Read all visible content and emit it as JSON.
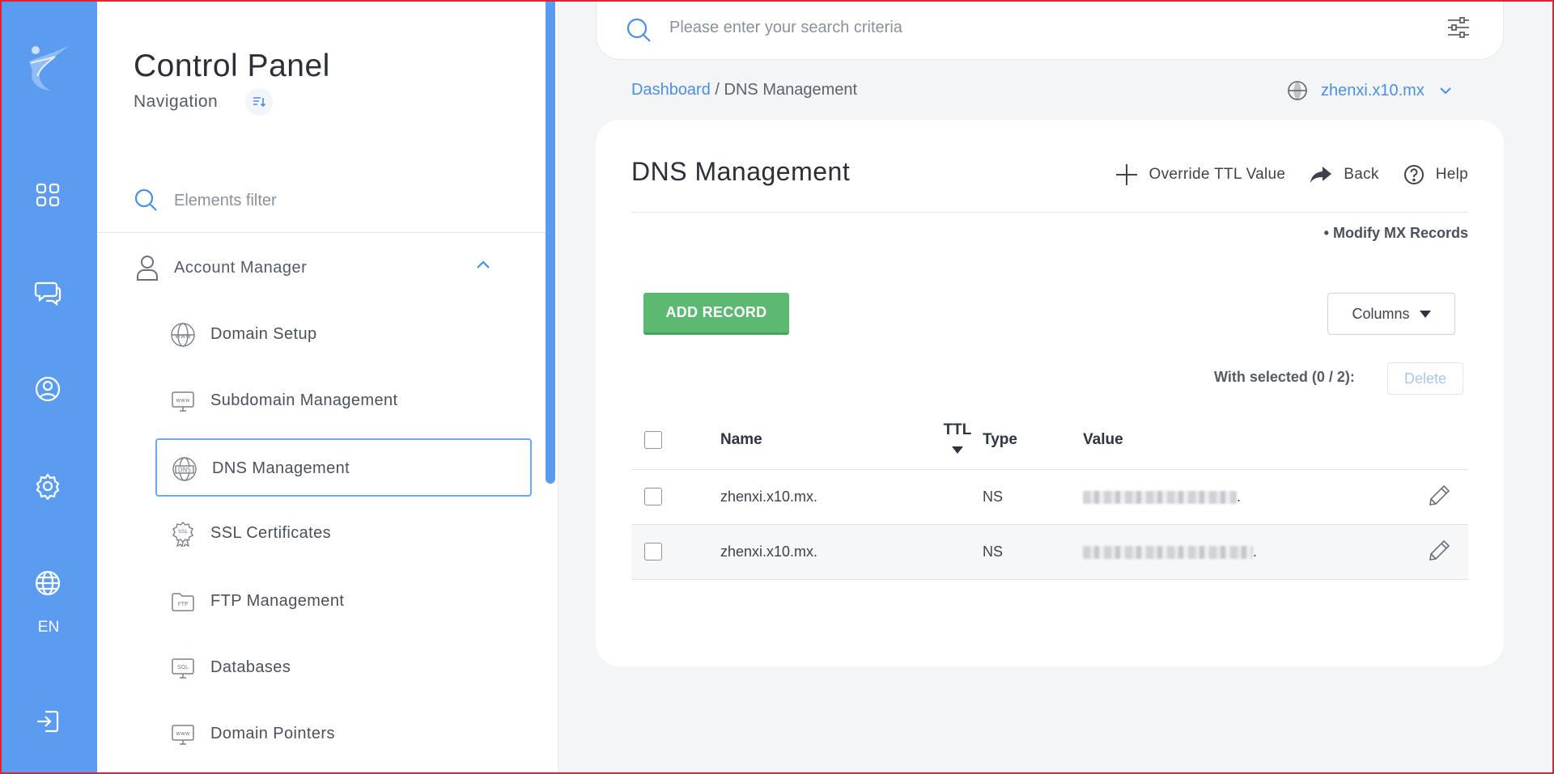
{
  "app": {
    "title": "Control Panel",
    "subtitle": "Navigation"
  },
  "rail": {
    "language": "EN",
    "icons": [
      "logo-icon",
      "dashboard-grid-icon",
      "chat-icon",
      "user-circle-icon",
      "gear-icon",
      "globe-icon",
      "logout-icon"
    ]
  },
  "sidebar": {
    "filter_placeholder": "Elements filter",
    "section": {
      "label": "Account Manager",
      "expanded": true
    },
    "items": [
      {
        "label": "Domain Setup",
        "icon": "www-globe-icon"
      },
      {
        "label": "Subdomain Management",
        "icon": "www-monitor-icon"
      },
      {
        "label": "DNS Management",
        "icon": "dns-globe-icon",
        "active": true
      },
      {
        "label": "SSL Certificates",
        "icon": "ssl-badge-icon"
      },
      {
        "label": "FTP Management",
        "icon": "ftp-folder-icon"
      },
      {
        "label": "Databases",
        "icon": "sql-monitor-icon"
      },
      {
        "label": "Domain Pointers",
        "icon": "www-monitor-icon"
      }
    ]
  },
  "search": {
    "placeholder": "Please enter your search criteria"
  },
  "breadcrumb": {
    "home": "Dashboard",
    "sep": "/",
    "current": "DNS Management"
  },
  "domain_selector": {
    "value": "zhenxi.x10.mx"
  },
  "page": {
    "title": "DNS Management",
    "actions": {
      "override": "Override TTL Value",
      "back": "Back",
      "help": "Help"
    },
    "mx_link": "• Modify MX Records",
    "add_record": "ADD RECORD",
    "columns": "Columns",
    "with_selected": "With selected (0 / 2):",
    "delete": "Delete"
  },
  "table": {
    "headers": {
      "name": "Name",
      "ttl": "TTL",
      "type": "Type",
      "value": "Value"
    },
    "rows": [
      {
        "name": "zhenxi.x10.mx.",
        "ttl": "",
        "type": "NS",
        "value_suffix": "."
      },
      {
        "name": "zhenxi.x10.mx.",
        "ttl": "",
        "type": "NS",
        "value_suffix": "."
      }
    ]
  },
  "colors": {
    "rail": "#5b9cf0",
    "accent": "#4a90e2",
    "add_button": "#5cb972",
    "frame": "#e0232e"
  }
}
